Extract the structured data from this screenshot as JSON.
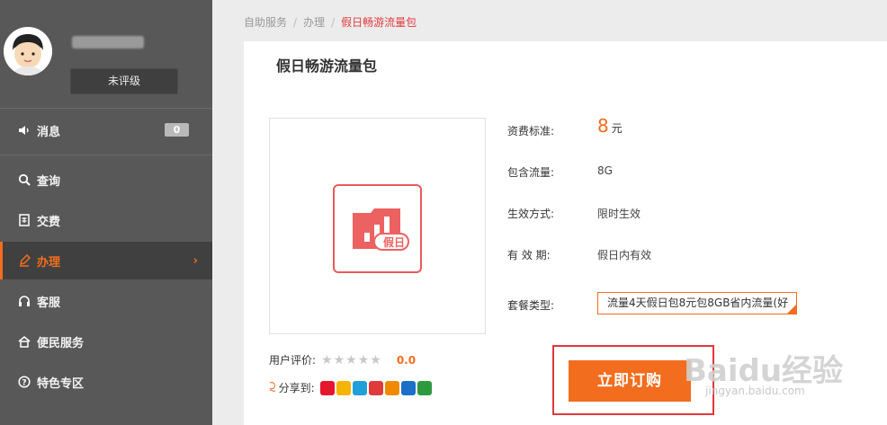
{
  "sidebar": {
    "rating_label": "未评级",
    "items": [
      {
        "label": "消息",
        "badge": "0"
      },
      {
        "label": "查询"
      },
      {
        "label": "交费"
      },
      {
        "label": "办理"
      },
      {
        "label": "客服"
      },
      {
        "label": "便民服务"
      },
      {
        "label": "特色专区"
      }
    ],
    "active_chevron": "›"
  },
  "breadcrumb": {
    "items": [
      "自助服务",
      "办理"
    ],
    "current": "假日畅游流量包",
    "separator": "/"
  },
  "product": {
    "title": "假日畅游流量包",
    "icon_label": "假日",
    "rows": [
      {
        "label": "资费标准:",
        "value_num": "8",
        "value_unit": "元"
      },
      {
        "label": "包含流量:",
        "value": "8G"
      },
      {
        "label": "生效方式:",
        "value": "限时生效"
      },
      {
        "label": "有 效 期:",
        "value": "假日内有效"
      },
      {
        "label": "套餐类型:",
        "value": "流量4天假日包8元包8GB省内流量(好"
      }
    ],
    "rating_label": "用户评价:",
    "rating_stars": "★★★★★",
    "rating_score": "0.0",
    "share_label": "分享到:",
    "buy_label": "立即订购"
  },
  "watermark": {
    "text": "Baidu经验",
    "sub": "jingyan.baidu.com"
  },
  "colors": {
    "accent": "#f26d1e",
    "sidebar_bg": "#585858",
    "highlight_red": "#e2373b"
  }
}
